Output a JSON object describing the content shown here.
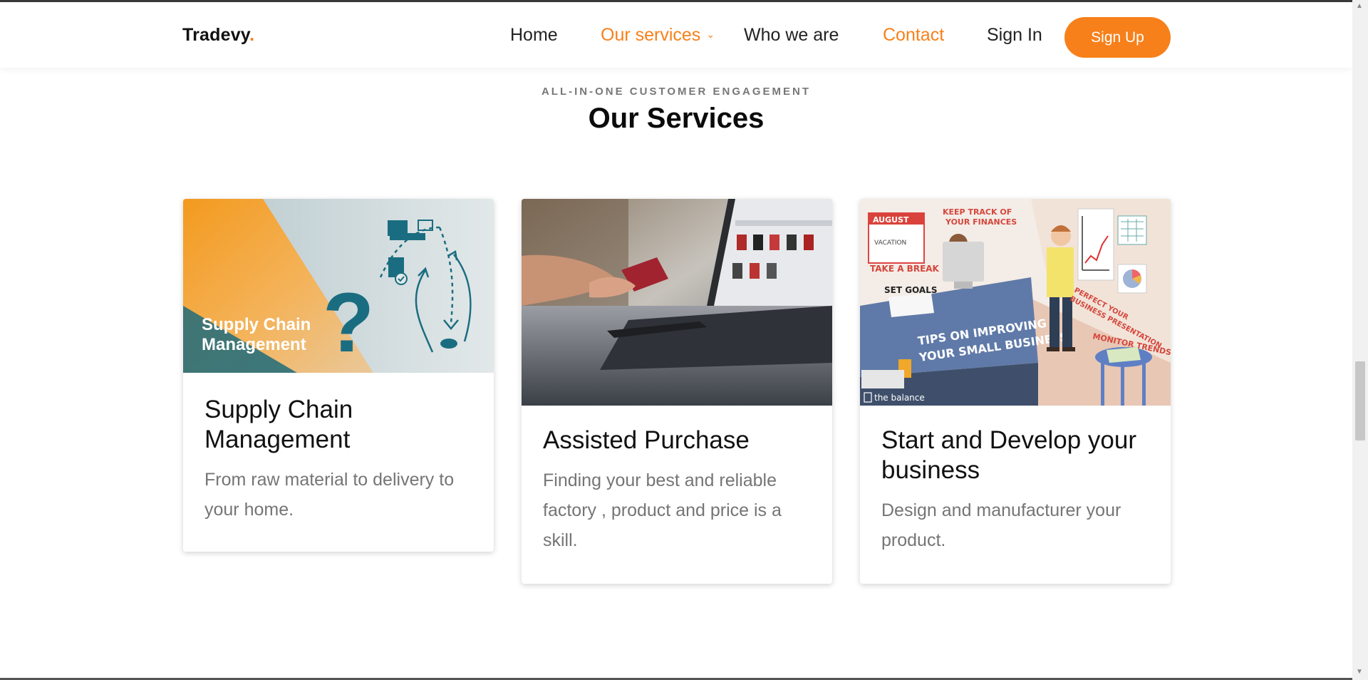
{
  "brand": {
    "name": "Tradevy",
    "dot": ".",
    "accent": "#f7801a"
  },
  "nav": {
    "home": "Home",
    "services": "Our services",
    "who": "Who we are",
    "contact": "Contact",
    "signin": "Sign In",
    "signup": "Sign Up"
  },
  "section": {
    "kicker": "ALL-IN-ONE CUSTOMER ENGAGEMENT",
    "title": "Our Services"
  },
  "cards": [
    {
      "title": "Supply Chain Management",
      "desc": "From raw material to delivery to your home.",
      "image_text": [
        "Supply Chain",
        "Management"
      ]
    },
    {
      "title": "Assisted Purchase",
      "desc": "Finding your best and reliable factory , product and price is a skill."
    },
    {
      "title": "Start and Develop your business",
      "desc": "Design and manufacturer your product.",
      "image_text": {
        "month": "AUGUST",
        "vacation": "VACATION",
        "break": "TAKE A BREAK",
        "keep1": "KEEP TRACK OF",
        "keep2": "YOUR FINANCES",
        "goals": "SET GOALS",
        "tips1": "TIPS ON IMPROVING",
        "tips2": "YOUR SMALL BUSINESS",
        "perfect1": "PERFECT YOUR",
        "perfect2": "BUSINESS PRESENTATION",
        "trends": "MONITOR TRENDS",
        "credit": "the balance"
      }
    }
  ]
}
